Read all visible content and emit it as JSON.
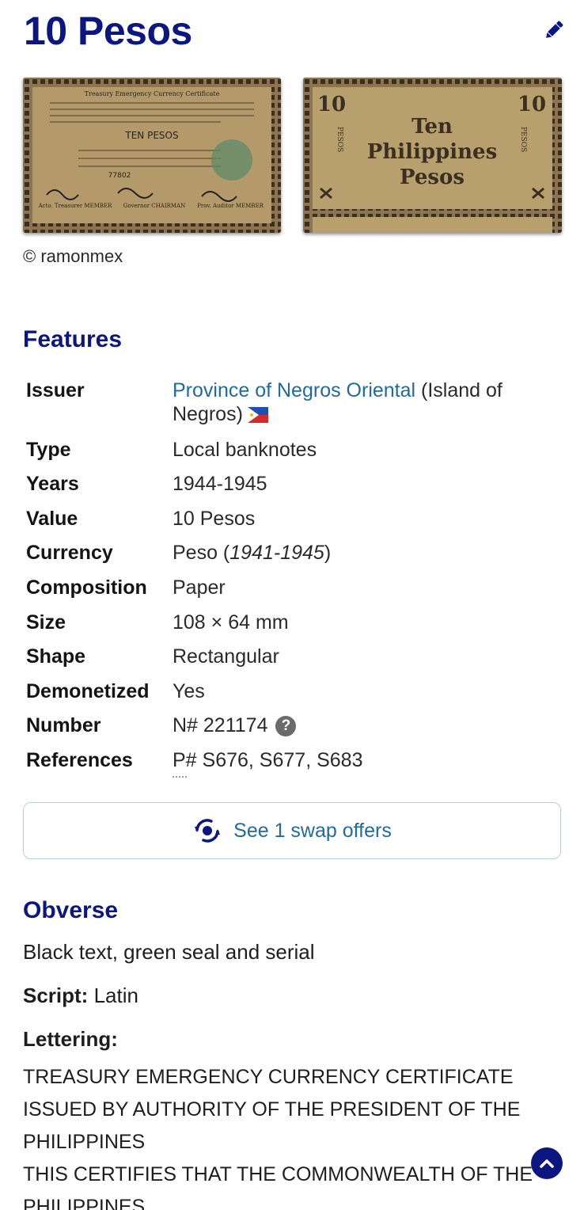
{
  "page": {
    "title": "10 Pesos",
    "edit_icon": "pencil-icon",
    "image_credit": "© ramonmex"
  },
  "banknote": {
    "obverse": {
      "header": "Treasury Emergency Currency Certificate",
      "denomination": "TEN PESOS",
      "serial": "77802",
      "signatories": [
        "Acto. Treasurer MEMBER",
        "Governor CHAIRMAN",
        "Prov. Auditor MEMBER"
      ]
    },
    "reverse": {
      "corner_value": "10",
      "side_text": "PESOS",
      "line1": "Ten",
      "line2": "Philippines",
      "line3": "Pesos"
    }
  },
  "features": {
    "heading": "Features",
    "rows": [
      {
        "label": "Issuer",
        "link": "Province of Negros Oriental",
        "text": " (Island of",
        "text2": "Negros)"
      },
      {
        "label": "Type",
        "link": "Local banknotes"
      },
      {
        "label": "Years",
        "value": "1944-1945"
      },
      {
        "label": "Value",
        "value": "10 Pesos"
      },
      {
        "label": "Currency",
        "value": "Peso (",
        "value_italic": "1941-1945",
        "value_end": ")"
      },
      {
        "label": "Composition",
        "value": "Paper"
      },
      {
        "label": "Size",
        "value": "108 × 64 mm"
      },
      {
        "label": "Shape",
        "value": "Rectangular"
      },
      {
        "label": "Demonetized",
        "value": "Yes"
      },
      {
        "label": "Number",
        "value": "N# 221174"
      },
      {
        "label": "References",
        "value": "P# S676, S677, S683"
      }
    ]
  },
  "swap": {
    "label": "See 1 swap offers",
    "icon": "swap-icon"
  },
  "obverse_section": {
    "heading": "Obverse",
    "description": "Black text, green seal and serial",
    "script_label": "Script:",
    "script_value": " Latin",
    "lettering_label": "Lettering:",
    "lettering_lines": [
      "TREASURY EMERGENCY CURRENCY CERTIFICATE",
      "ISSUED BY AUTHORITY OF THE PRESIDENT OF THE",
      "PHILIPPINES",
      "THIS CERTIFIES THAT THE COMMONWEALTH OF THE",
      "PHILIPPINES"
    ]
  },
  "colors": {
    "heading": "#0c1680",
    "link": "#1f6a9e",
    "paper": "#b49a6a"
  }
}
